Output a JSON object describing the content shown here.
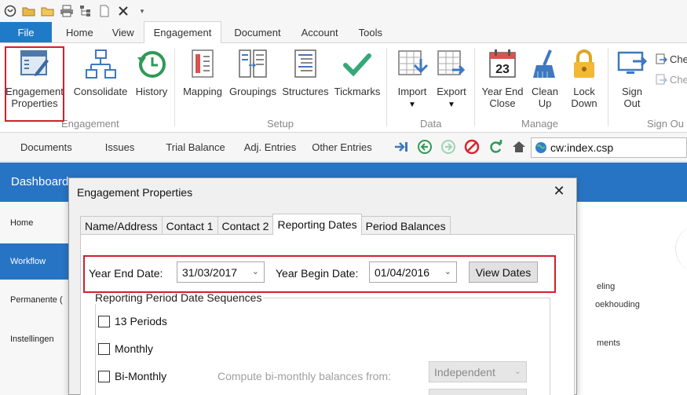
{
  "ribbon_tabs": {
    "file": "File",
    "home": "Home",
    "view": "View",
    "engagement": "Engagement",
    "document": "Document",
    "account": "Account",
    "tools": "Tools"
  },
  "ribbon": {
    "engagement_properties": [
      "Engagement",
      "Properties"
    ],
    "consolidate": "Consolidate",
    "history": "History",
    "group_engagement": "Engagement",
    "mapping": "Mapping",
    "groupings": "Groupings",
    "structures": "Structures",
    "tickmarks": "Tickmarks",
    "group_setup": "Setup",
    "import": "Import",
    "export": "Export",
    "group_data": "Data",
    "year_end_close": [
      "Year End",
      "Close"
    ],
    "clean_up": [
      "Clean",
      "Up"
    ],
    "lock_down": [
      "Lock",
      "Down"
    ],
    "group_manage": "Manage",
    "sign_out": [
      "Sign",
      "Out"
    ],
    "group_sign_out": "Sign Ou",
    "check_1": "Che",
    "check_2": "Che",
    "calendar_day": "23"
  },
  "nav": {
    "documents": "Documents",
    "issues": "Issues",
    "trial_balance": "Trial Balance",
    "adj_entries": "Adj. Entries",
    "other_entries": "Other Entries",
    "url": "cw:index.csp"
  },
  "dashboard": {
    "title": "Dashboard",
    "sidebar": [
      "Home",
      "Workflow",
      "Permanente (",
      "Instellingen"
    ],
    "bg_texts": [
      "eling",
      "oekhouding",
      "ments"
    ]
  },
  "dialog": {
    "title": "Engagement Properties",
    "close": "✕",
    "tabs": [
      "Name/Address",
      "Contact 1",
      "Contact 2",
      "Reporting Dates",
      "Period Balances"
    ],
    "active_tab": "Reporting Dates",
    "year_end_label": "Year End Date:",
    "year_end_value": "31/03/2017",
    "year_begin_label": "Year Begin Date:",
    "year_begin_value": "01/04/2016",
    "view_dates": "View Dates",
    "group_title": "Reporting Period Date Sequences",
    "cb_13": "13 Periods",
    "cb_monthly": "Monthly",
    "cb_bimonthly": "Bi-Monthly",
    "compute_label": "Compute bi-monthly balances from:",
    "compute_value": "Independent"
  },
  "colors": {
    "accent_blue": "#2874c4",
    "file_tab": "#1f7bc8",
    "highlight_red": "#d0202c"
  }
}
